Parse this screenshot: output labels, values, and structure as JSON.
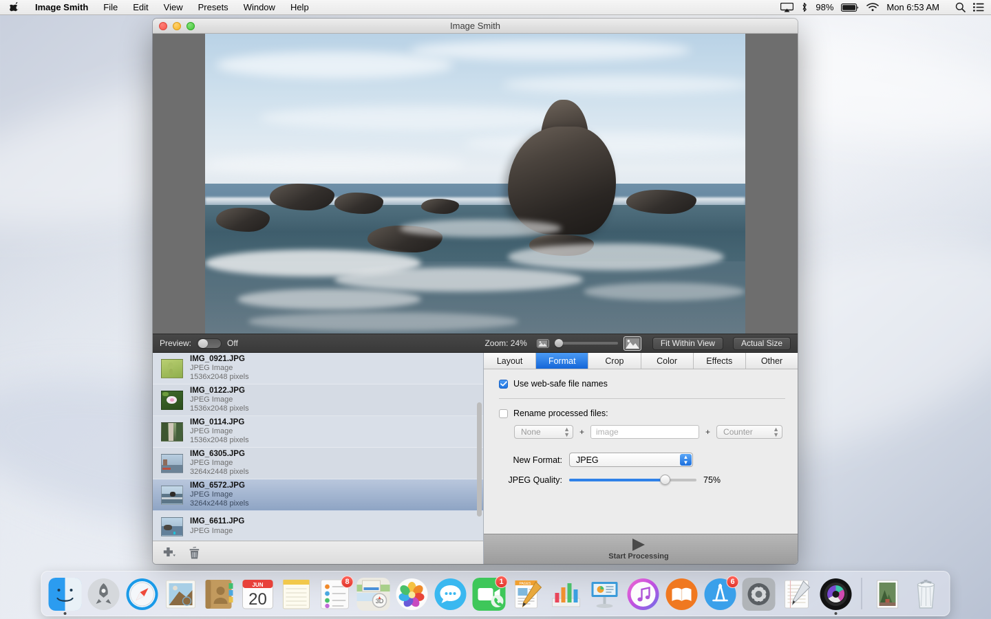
{
  "menubar": {
    "apple_icon": "apple-icon",
    "app_name": "Image Smith",
    "items": [
      "File",
      "Edit",
      "View",
      "Presets",
      "Window",
      "Help"
    ],
    "status": {
      "airplay_icon": "airplay-icon",
      "bluetooth_icon": "bluetooth-icon",
      "battery_percent": "98%",
      "battery_icon": "battery-icon",
      "wifi_icon": "wifi-icon",
      "clock": "Mon 6:53 AM",
      "search_icon": "search-icon",
      "notification_center_icon": "notification-center-icon"
    }
  },
  "window": {
    "title": "Image Smith",
    "traffic_lights": [
      "close",
      "minimize",
      "zoom"
    ]
  },
  "preview_toolbar": {
    "preview_label": "Preview:",
    "preview_state": "Off",
    "zoom_label": "Zoom: 24%",
    "zoom_percent": 24,
    "small_image_icon": "small-image-icon",
    "large_image_icon": "large-image-icon",
    "fit_button": "Fit Within View",
    "actual_button": "Actual Size"
  },
  "file_list": {
    "items": [
      {
        "name": "IMG_0921.JPG",
        "type": "JPEG Image",
        "dimensions": "1536x2048 pixels",
        "selected": false,
        "thumb": "green"
      },
      {
        "name": "IMG_0122.JPG",
        "type": "JPEG Image",
        "dimensions": "1536x2048 pixels",
        "selected": false,
        "thumb": "flower"
      },
      {
        "name": "IMG_0114.JPG",
        "type": "JPEG Image",
        "dimensions": "1536x2048 pixels",
        "selected": false,
        "thumb": "road"
      },
      {
        "name": "IMG_6305.JPG",
        "type": "JPEG Image",
        "dimensions": "3264x2448 pixels",
        "selected": false,
        "thumb": "pier"
      },
      {
        "name": "IMG_6572.JPG",
        "type": "JPEG Image",
        "dimensions": "3264x2448 pixels",
        "selected": true,
        "thumb": "coast"
      },
      {
        "name": "IMG_6611.JPG",
        "type": "JPEG Image",
        "dimensions": "",
        "selected": false,
        "thumb": "coast2"
      }
    ],
    "add_icon": "add-plus-icon",
    "remove_icon": "trash-icon"
  },
  "inspector": {
    "tabs": [
      {
        "label": "Layout",
        "active": false
      },
      {
        "label": "Format",
        "active": true
      },
      {
        "label": "Crop",
        "active": false
      },
      {
        "label": "Color",
        "active": false
      },
      {
        "label": "Effects",
        "active": false
      },
      {
        "label": "Other",
        "active": false
      }
    ],
    "websafe": {
      "label": "Use web-safe file names",
      "checked": true
    },
    "rename": {
      "label": "Rename processed files:",
      "checked": false,
      "prefix_select": "None",
      "name_field_placeholder": "image",
      "name_field_value": "",
      "suffix_select": "Counter",
      "plus_symbol": "+"
    },
    "new_format": {
      "label": "New Format:",
      "value": "JPEG"
    },
    "quality": {
      "label": "JPEG Quality:",
      "value": "75%",
      "percent": 75
    }
  },
  "footer": {
    "start_label": "Start Processing",
    "play_icon": "play-triangle-icon"
  },
  "dock": {
    "items": [
      {
        "name": "finder",
        "badge": "",
        "running": true
      },
      {
        "name": "launchpad",
        "badge": "",
        "running": false
      },
      {
        "name": "safari",
        "badge": "",
        "running": false
      },
      {
        "name": "mail",
        "badge": "",
        "running": false
      },
      {
        "name": "contacts",
        "badge": "",
        "running": false
      },
      {
        "name": "calendar",
        "badge": "",
        "running": false,
        "month": "JUN",
        "day": "20"
      },
      {
        "name": "notes",
        "badge": "",
        "running": false
      },
      {
        "name": "reminders",
        "badge": "8",
        "running": false
      },
      {
        "name": "maps",
        "badge": "",
        "running": false
      },
      {
        "name": "photos",
        "badge": "",
        "running": false
      },
      {
        "name": "messages",
        "badge": "",
        "running": false
      },
      {
        "name": "facetime",
        "badge": "1",
        "running": false
      },
      {
        "name": "pages",
        "badge": "",
        "running": false
      },
      {
        "name": "numbers",
        "badge": "",
        "running": false
      },
      {
        "name": "keynote",
        "badge": "",
        "running": false
      },
      {
        "name": "itunes",
        "badge": "",
        "running": false
      },
      {
        "name": "ibooks",
        "badge": "",
        "running": false
      },
      {
        "name": "app-store",
        "badge": "6",
        "running": false
      },
      {
        "name": "system-preferences",
        "badge": "",
        "running": false
      },
      {
        "name": "textedit",
        "badge": "",
        "running": false
      },
      {
        "name": "image-smith",
        "badge": "",
        "running": true
      },
      {
        "name": "photo-stack",
        "badge": "",
        "running": false
      },
      {
        "name": "trash",
        "badge": "",
        "running": false
      }
    ]
  },
  "colors": {
    "accent_blue": "#1466d8",
    "selection_blue": "#8ea4c4",
    "badge_red": "#e0362c",
    "toolbar_dark": "#3f3f3f"
  }
}
